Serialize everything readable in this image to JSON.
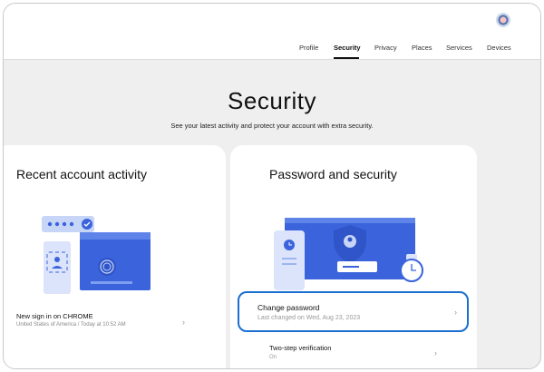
{
  "header": {
    "nav": [
      {
        "label": "Profile",
        "active": false
      },
      {
        "label": "Security",
        "active": true
      },
      {
        "label": "Privacy",
        "active": false
      },
      {
        "label": "Places",
        "active": false
      },
      {
        "label": "Services",
        "active": false
      },
      {
        "label": "Devices",
        "active": false
      }
    ],
    "avatar_icon": "profile-avatar-icon"
  },
  "hero": {
    "title": "Security",
    "subtitle": "See your latest activity and protect your account with extra security."
  },
  "recent_activity": {
    "title": "Recent account activity",
    "item_title": "New sign in on CHROME",
    "item_subtitle": "United States of America / Today at 10:52 AM"
  },
  "password_security": {
    "title": "Password and security",
    "change_password_title": "Change password",
    "change_password_subtitle": "Last changed on Wed, Aug 23, 2023",
    "two_step_title": "Two-step verification",
    "two_step_status": "On"
  },
  "colors": {
    "accent": "#1a6fd1",
    "illustration_blue": "#3a63dc",
    "illustration_light": "#c7d5f7"
  }
}
